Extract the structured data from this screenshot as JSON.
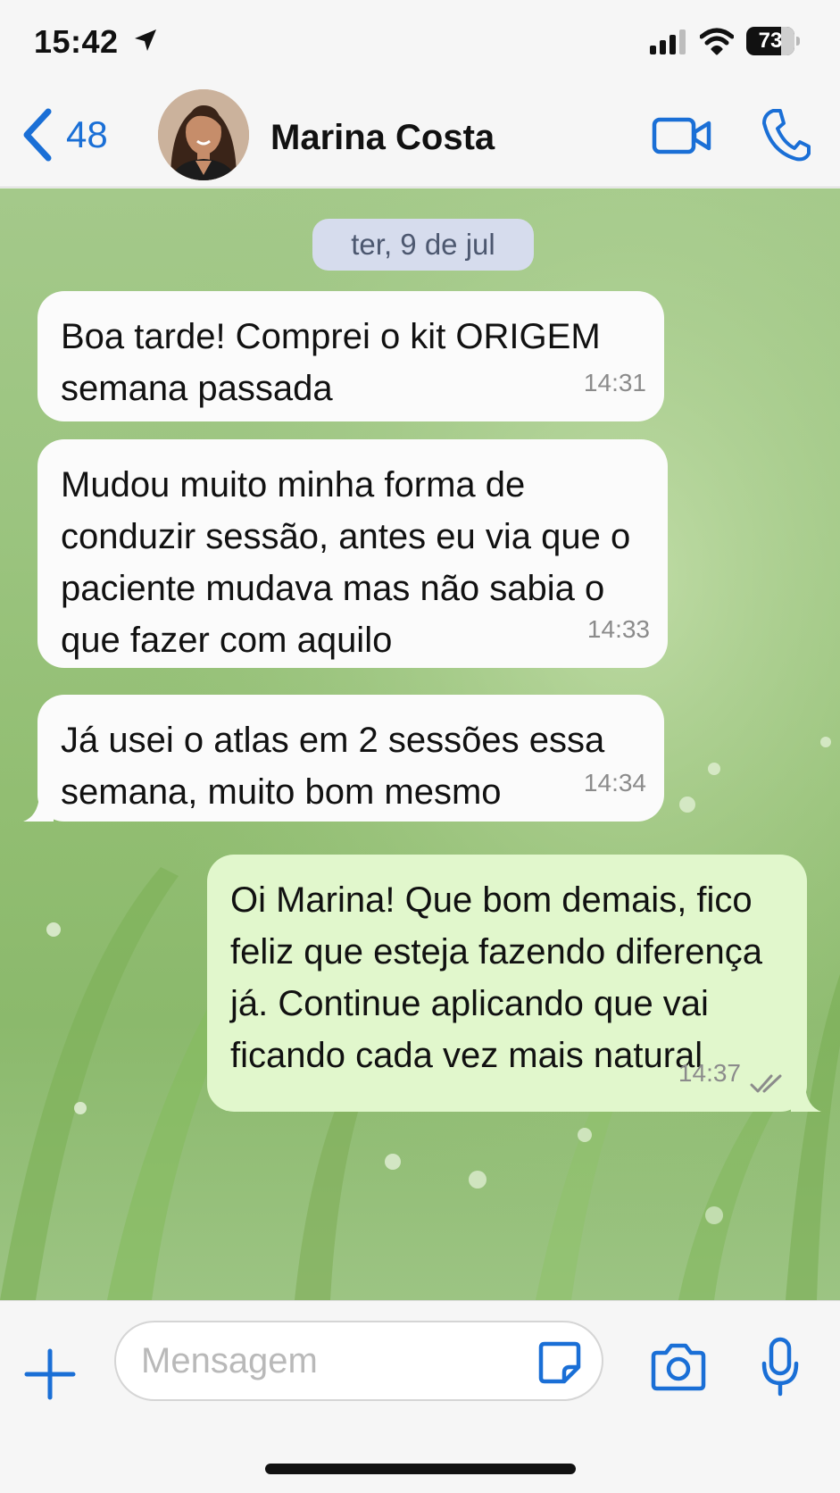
{
  "status_bar": {
    "time": "15:42",
    "battery": "73",
    "battery_level": 0.73,
    "icons": [
      "location-arrow-icon",
      "cellular-signal-icon",
      "wifi-icon",
      "battery-icon"
    ]
  },
  "header": {
    "back_count": "48",
    "contact_name": "Marina Costa",
    "icons": [
      "back-chevron-icon",
      "video-call-icon",
      "phone-icon"
    ]
  },
  "chat": {
    "date_chip": "ter, 9 de jul",
    "messages": [
      {
        "direction": "incoming",
        "text": "Boa tarde! Comprei o kit ORIGEM semana passada",
        "time": "14:31"
      },
      {
        "direction": "incoming",
        "text": "Mudou muito minha forma de conduzir sessão, antes eu via que o paciente mudava mas não sabia o que fazer com aquilo",
        "time": "14:33"
      },
      {
        "direction": "incoming",
        "text": "Já usei o atlas em 2 sessões essa semana, muito bom mesmo",
        "time": "14:34"
      },
      {
        "direction": "outgoing",
        "text": "Oi Marina! Que bom demais, fico feliz que esteja fazendo diferença já. Continue aplicando que vai ficando cada vez mais natural",
        "time": "14:37",
        "status": "read-double-check-icon"
      }
    ]
  },
  "input_bar": {
    "placeholder": "Mensagem",
    "icons": [
      "plus-icon",
      "sticker-icon",
      "camera-icon",
      "microphone-icon"
    ]
  },
  "colors": {
    "accent": "#1a6fd6",
    "incoming_bubble": "#fbfbfb",
    "outgoing_bubble": "#e1f7cc",
    "date_chip": "#d6dced",
    "wallpaper": "#9bc47f"
  }
}
